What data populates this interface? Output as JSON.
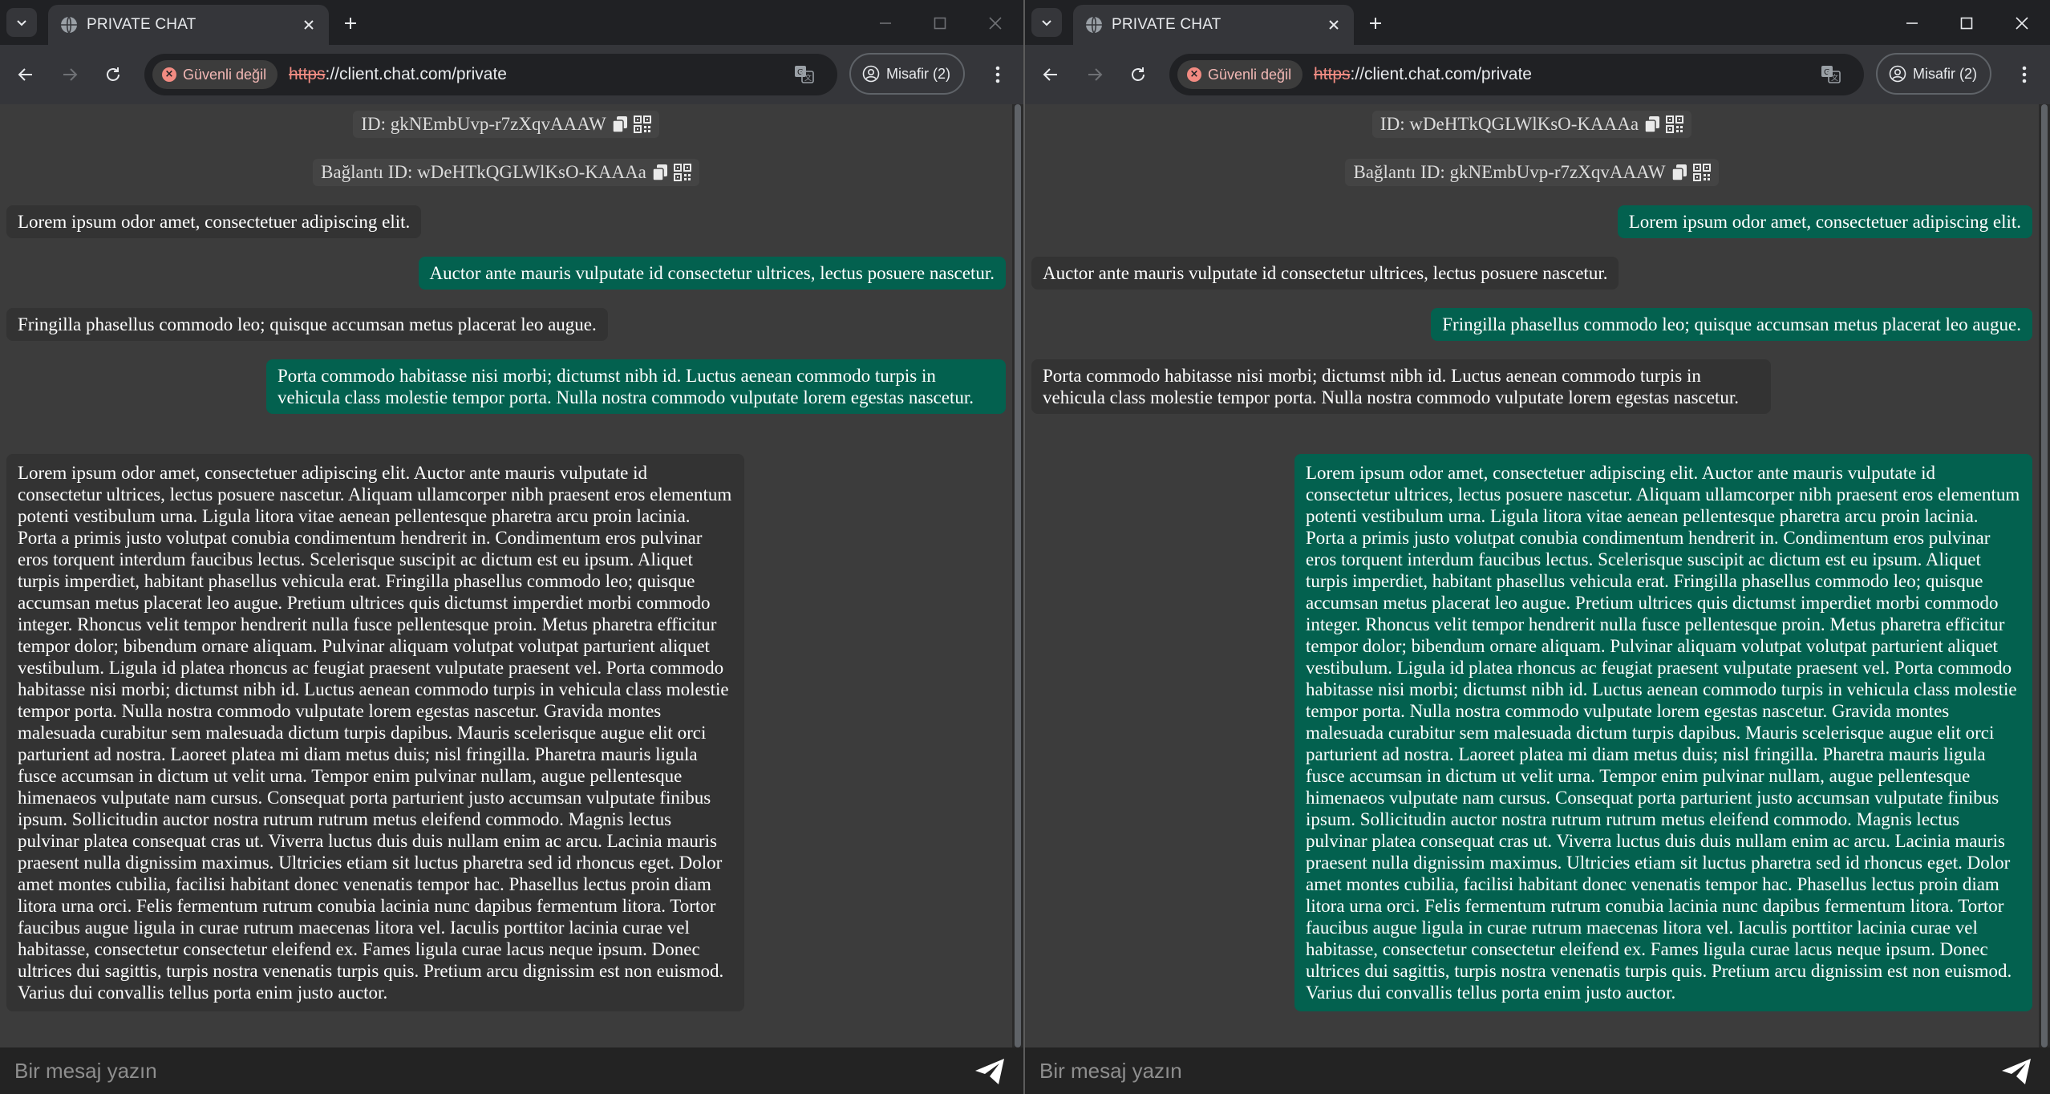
{
  "browser": {
    "tab_title": "PRIVATE CHAT",
    "security_chip": "Güvenli değil",
    "url_scheme": "https",
    "url_rest": "://client.chat.com/private",
    "profile_label": "Misafir (2)"
  },
  "left_window": {
    "my_id_text": "ID: gkNEmbUvp-r7zXqvAAAW",
    "peer_id_text": "Bağlantı ID: wDeHTkQGLWlKsO-KAAAa",
    "input_placeholder": "Bir mesaj yazın"
  },
  "right_window": {
    "my_id_text": "ID: wDeHTkQGLWlKsO-KAAAa",
    "peer_id_text": "Bağlantı ID: gkNEmbUvp-r7zXqvAAAW",
    "input_placeholder": "Bir mesaj yazın"
  },
  "messages": [
    "Lorem ipsum odor amet, consectetuer adipiscing elit.",
    "Auctor ante mauris vulputate id consectetur ultrices, lectus posuere nascetur.",
    "Fringilla phasellus commodo leo; quisque accumsan metus placerat leo augue.",
    "Porta commodo habitasse nisi morbi; dictumst nibh id. Luctus aenean commodo turpis in vehicula class molestie tempor porta. Nulla nostra commodo vulputate lorem egestas nascetur.",
    "Lorem ipsum odor amet, consectetuer adipiscing elit. Auctor ante mauris vulputate id consectetur ultrices, lectus posuere nascetur. Aliquam ullamcorper nibh praesent eros elementum potenti vestibulum urna. Ligula litora vitae aenean pellentesque pharetra arcu proin lacinia. Porta a primis justo volutpat conubia condimentum hendrerit in. Condimentum eros pulvinar eros torquent interdum faucibus lectus. Scelerisque suscipit ac dictum est eu ipsum. Aliquet turpis imperdiet, habitant phasellus vehicula erat. Fringilla phasellus commodo leo; quisque accumsan metus placerat leo augue. Pretium ultrices quis dictumst imperdiet morbi commodo integer. Rhoncus velit tempor hendrerit nulla fusce pellentesque proin. Metus pharetra efficitur tempor dolor; bibendum ornare aliquam. Pulvinar aliquam volutpat volutpat parturient aliquet vestibulum. Ligula id platea rhoncus ac feugiat praesent vulputate praesent vel. Porta commodo habitasse nisi morbi; dictumst nibh id. Luctus aenean commodo turpis in vehicula class molestie tempor porta. Nulla nostra commodo vulputate lorem egestas nascetur. Gravida montes malesuada curabitur sem malesuada dictum turpis dapibus. Mauris scelerisque augue elit orci parturient ad nostra. Laoreet platea mi diam metus duis; nisl fringilla. Pharetra mauris ligula fusce accumsan in dictum ut velit urna. Tempor enim pulvinar nullam, augue pellentesque himenaeos vulputate nam cursus. Consequat porta parturient justo accumsan vulputate finibus ipsum. Sollicitudin auctor nostra rutrum rutrum metus eleifend commodo. Magnis lectus pulvinar platea consequat cras ut. Viverra luctus duis duis nullam enim ac arcu. Lacinia mauris praesent nulla dignissim maximus. Ultricies etiam sit luctus pharetra sed id rhoncus eget. Dolor amet montes cubilia, facilisi habitant donec venenatis tempor hac. Phasellus lectus proin diam litora urna orci. Felis fermentum rutrum conubia lacinia nunc dapibus fermentum litora. Tortor faucibus augue ligula in curae rutrum maecenas litora vel. Iaculis porttitor lacinia curae vel habitasse, consectetur consectetur eleifend ex. Fames ligula curae lacus neque ipsum. Donec ultrices dui sagittis, turpis nostra venenatis turpis quis. Pretium arcu dignissim est non euismod. Varius dui convallis tellus porta enim justo auctor."
  ],
  "colors": {
    "sent_bubble": "#03614f",
    "received_bubble": "#333333",
    "insecure_warning": "#f28b82"
  },
  "icons": {
    "tab_search": "chevron-down-icon",
    "favicon": "globe-icon",
    "close": "close-icon",
    "new_tab": "plus-icon",
    "copy": "copy-icon",
    "qr": "qr-code-icon",
    "send": "send-icon"
  }
}
